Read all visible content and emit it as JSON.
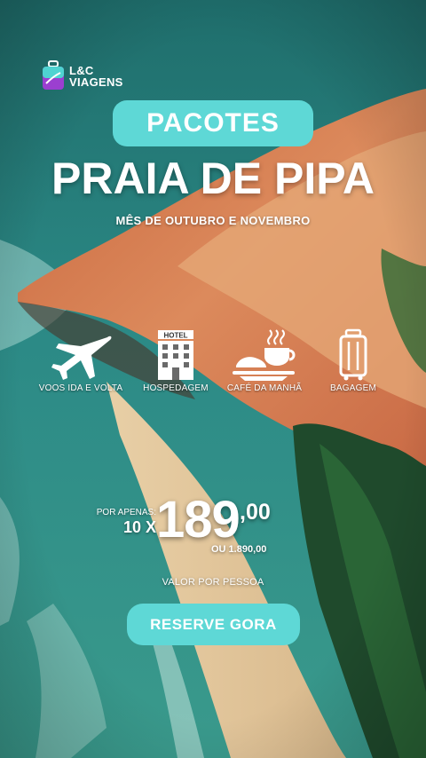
{
  "brand": {
    "name_line1": "L&C",
    "name_line2": "VIAGENS",
    "logo_icon": "suitcase-icon"
  },
  "header": {
    "badge": "PACOTES",
    "title": "PRAIA DE PIPA",
    "subtitle": "MÊS DE OUTUBRO E NOVEMBRO"
  },
  "features": [
    {
      "icon": "airplane-icon",
      "label": "VOOS  IDA E VOLTA"
    },
    {
      "icon": "hotel-icon",
      "label": "HOSPEDAGEM",
      "sign": "HOTEL"
    },
    {
      "icon": "coffee-icon",
      "label": "CAFÉ DA MANHÃ"
    },
    {
      "icon": "luggage-icon",
      "label": "BAGAGEM"
    }
  ],
  "price": {
    "prefix": "POR APENAS:",
    "installments": "10 X",
    "amount": "189",
    "cents": ",00",
    "total": "OU 1.890,00",
    "note": "VALOR POR PESSOA"
  },
  "cta": {
    "label": "RESERVE GORA"
  },
  "colors": {
    "accent": "#5ed8d6",
    "ocean": "#1d6f6e",
    "sand_cliff": "#d07a4e",
    "text": "#ffffff"
  }
}
